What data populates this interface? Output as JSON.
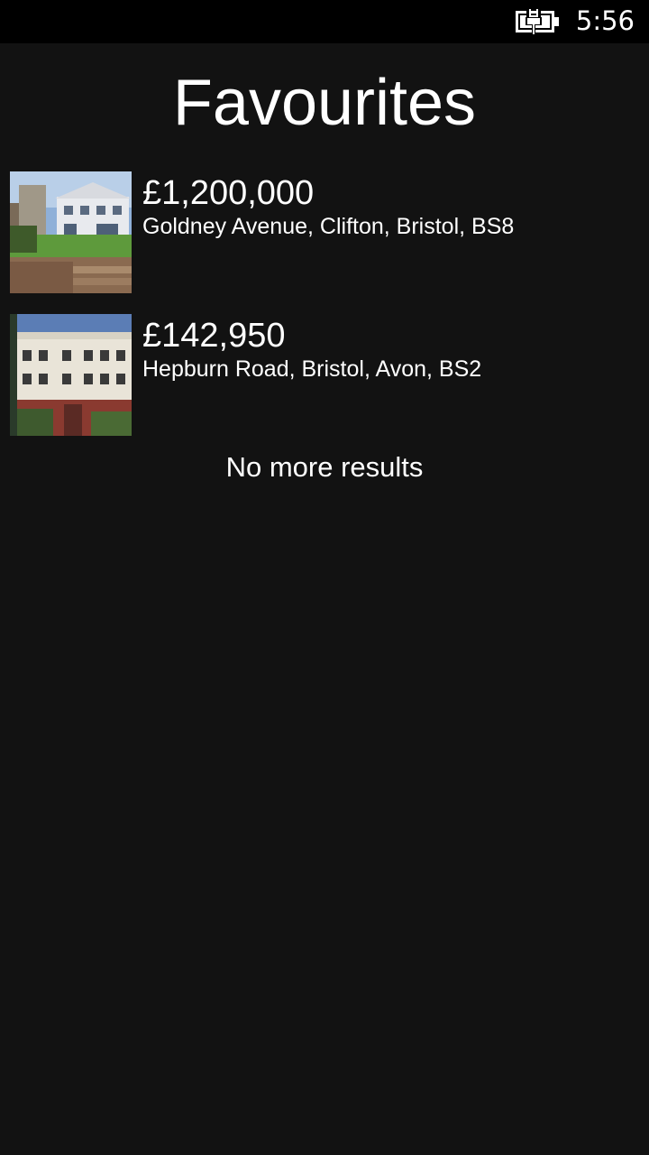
{
  "status_bar": {
    "time": "5:56",
    "battery_icon": "battery-charging-icon"
  },
  "page": {
    "title": "Favourites"
  },
  "listings": [
    {
      "price": "£1,200,000",
      "address": "Goldney Avenue, Clifton, Bristol, BS8",
      "thumbnail": "detached-house-photo"
    },
    {
      "price": "£142,950",
      "address": "Hepburn Road, Bristol, Avon, BS2",
      "thumbnail": "apartment-block-photo"
    }
  ],
  "footer": {
    "message": "No more results"
  }
}
